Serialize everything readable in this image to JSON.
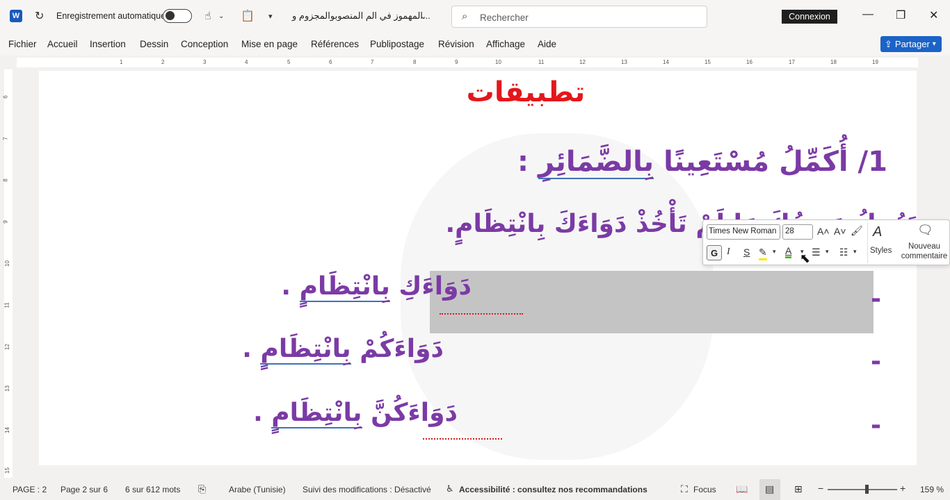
{
  "titlebar": {
    "app_icon": "word-logo",
    "autosave_label": "Enregistrement automatique",
    "autosave_state": "off",
    "document_title": "المهموز في الم المنصوبوالمجزوم و...",
    "search_placeholder": "Rechercher",
    "connexion_label": "Connexion"
  },
  "menu": {
    "items": [
      "Fichier",
      "Accueil",
      "Insertion",
      "Dessin",
      "Conception",
      "Mise en page",
      "Références",
      "Publipostage",
      "Révision",
      "Affichage",
      "Aide"
    ],
    "share_label": "Partager"
  },
  "ruler": {
    "h_ticks": [
      "1",
      "2",
      "3",
      "4",
      "5",
      "6",
      "7",
      "8",
      "9",
      "10",
      "11",
      "12",
      "13",
      "14",
      "15",
      "16",
      "17",
      "18",
      "19"
    ],
    "v_ticks": [
      "6",
      "7",
      "8",
      "9",
      "10",
      "11",
      "12",
      "13",
      "14",
      "15"
    ]
  },
  "document": {
    "title": "تطبيقات",
    "q1_number": "1/",
    "q1_text": "أُكَمِّلُ مُسْتَعِينًا",
    "q1_underlined": "بِالضَّمَائِرِ",
    "q1_colon": ":",
    "sentence": "يَزُولُ مَرَضُكَ مَا لَمْ تَأْخُذْ دَوَاءَكَ بِانْتِظَامٍ.",
    "line_a_text": "دَوَاءَكِ",
    "line_a_underlined": "بِانْتِظَامٍ",
    "line_a_end": ".",
    "line_b_text": "دَوَاءَكُمْ",
    "line_b_underlined": "بِانْتِظَامٍ",
    "line_b_end": ".",
    "line_c_text": "دَوَاءَكُنَّ",
    "line_c_underlined": "بِانْتِظَامٍ",
    "line_c_end": ".",
    "dash": "-"
  },
  "mini_toolbar": {
    "font": "Times New Roman",
    "size": "28",
    "styles_label": "Styles",
    "comment_label_1": "Nouveau",
    "comment_label_2": "commentaire"
  },
  "status": {
    "page": "PAGE : 2",
    "page_of": "Page 2 sur 6",
    "words": "6 sur 612 mots",
    "language": "Arabe (Tunisie)",
    "track_changes": "Suivi des modifications : Désactivé",
    "accessibility": "Accessibilité : consultez nos recommandations",
    "focus": "Focus",
    "zoom": "159 %"
  },
  "colors": {
    "title_red": "#e3171b",
    "text_purple": "#7b3aa5",
    "share_blue": "#1b63c6"
  }
}
